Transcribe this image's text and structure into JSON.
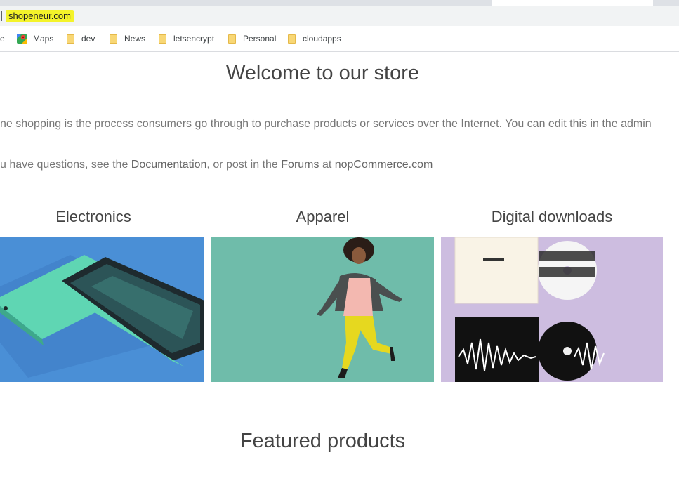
{
  "browser": {
    "url": "shopeneur.com",
    "bookmarks": [
      {
        "label": "e",
        "icon": "partial-icon"
      },
      {
        "label": "Maps",
        "icon": "maps-pin-icon"
      },
      {
        "label": "dev",
        "icon": "folder-icon"
      },
      {
        "label": "News",
        "icon": "folder-icon"
      },
      {
        "label": "letsencrypt",
        "icon": "folder-icon"
      },
      {
        "label": "Personal",
        "icon": "folder-icon"
      },
      {
        "label": "cloudapps",
        "icon": "folder-icon"
      }
    ]
  },
  "page": {
    "welcome_title": "Welcome to our store",
    "intro_text": "ne shopping is the process consumers go through to purchase products or services over the Internet. You can edit this in the admin",
    "help_prefix": "u have questions, see the ",
    "documentation_link": "Documentation",
    "help_middle": ", or post in the ",
    "forums_link": "Forums",
    "help_at": " at ",
    "nopcommerce_link": "nopCommerce.com",
    "categories": [
      {
        "name": "Electronics"
      },
      {
        "name": "Apparel"
      },
      {
        "name": "Digital downloads"
      }
    ],
    "featured_title": "Featured products"
  },
  "colors": {
    "url_highlight": "#f4f32a",
    "electronics_bg": "#4a8fd6",
    "apparel_bg": "#6fbcaa",
    "downloads_bg": "#cdbde0"
  }
}
